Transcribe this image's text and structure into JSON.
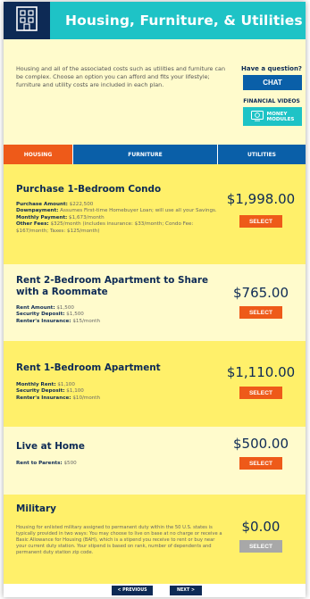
{
  "header": {
    "title": "Housing, Furniture, & Utilities",
    "icon": "building-icon"
  },
  "intro": {
    "text": "Housing and all of the associated costs such as utilities and furniture can be complex. Choose an option you can afford and fits your lifestyle; furniture and utility costs are included in each plan.",
    "question_label": "Have a question?",
    "chat_label": "CHAT",
    "financial_videos_label": "FINANCIAL VIDEOS",
    "money_modules_line1": "MONEY",
    "money_modules_line2": "MODULES"
  },
  "tabs": [
    {
      "label": "HOUSING",
      "active": true
    },
    {
      "label": "FURNITURE",
      "active": false
    },
    {
      "label": "UTILITIES",
      "active": false
    }
  ],
  "options": [
    {
      "title": "Purchase 1-Bedroom Condo",
      "details": [
        {
          "label": "Purchase Amount:",
          "value": " $222,500"
        },
        {
          "label": "Downpayment:",
          "value": " Assumes First-time Homebuyer Loan; will use all your Savings."
        },
        {
          "label": "Monthly Payment:",
          "value": " $1,673/month"
        },
        {
          "label": "Other Fees:",
          "value": " $325/month (includes insurance: $33/month; Condo Fee: $167/month; Taxes: $125/month)"
        }
      ],
      "price": "$1,998.00",
      "select_label": "SELECT",
      "enabled": true
    },
    {
      "title": "Rent 2-Bedroom Apartment to Share with a Roommate",
      "details": [
        {
          "label": "Rent Amount:",
          "value": " $1,500"
        },
        {
          "label": "Security Deposit:",
          "value": " $1,500"
        },
        {
          "label": "Renter's Insurance:",
          "value": " $15/month"
        }
      ],
      "price": "$765.00",
      "select_label": "SELECT",
      "enabled": true
    },
    {
      "title": "Rent 1-Bedroom Apartment",
      "details": [
        {
          "label": "Monthly Rent:",
          "value": " $1,100"
        },
        {
          "label": "Security Deposit:",
          "value": " $1,100"
        },
        {
          "label": "Renter's Insurance:",
          "value": " $10/month"
        }
      ],
      "price": "$1,110.00",
      "select_label": "SELECT",
      "enabled": true
    },
    {
      "title": "Live at Home",
      "details": [
        {
          "label": "Rent to Parents:",
          "value": " $500"
        }
      ],
      "price": "$500.00",
      "select_label": "SELECT",
      "enabled": true
    },
    {
      "title": "Military",
      "details": [
        {
          "label": "",
          "value": "Housing for enlisted military assigned to permanent duty within the 50 U.S. states is typically provided in two ways: You may choose to live on base at no charge or receive a Basic Allowance for Housing (BAH), which is a stipend you receive to rent or buy near your current duty station. Your stipend is based on rank, number of dependents and permanent duty station zip code."
        }
      ],
      "price": "$0.00",
      "select_label": "SELECT",
      "enabled": false
    }
  ],
  "nav": {
    "previous_label": "< PREVIOUS",
    "next_label": "NEXT >"
  },
  "colors": {
    "navy": "#0d2a55",
    "teal": "#1ec3c6",
    "orange": "#ee5a19",
    "blue": "#0a5fa8",
    "light_yellow": "#fffbcc",
    "yellow": "#fff06a",
    "disabled_gray": "#a8a8a8"
  }
}
